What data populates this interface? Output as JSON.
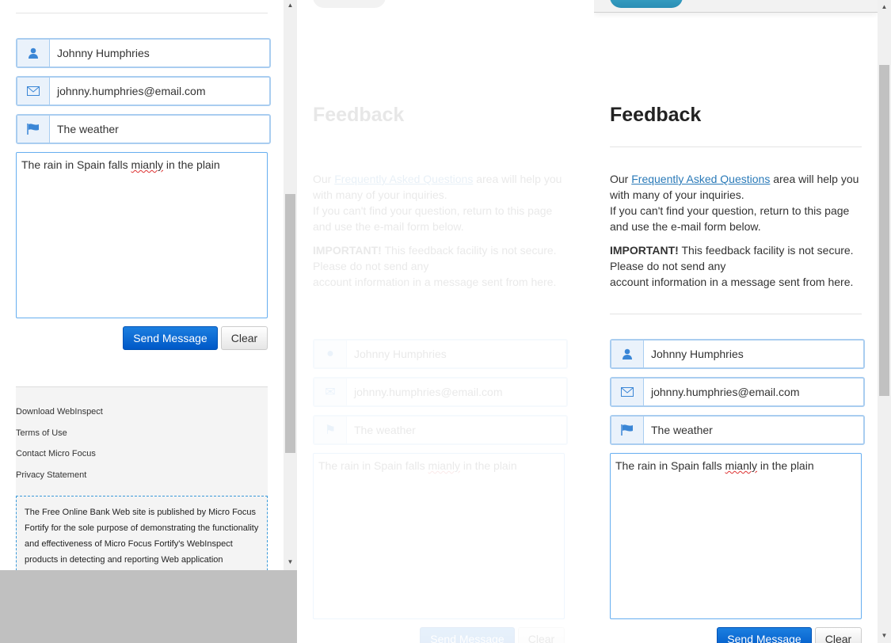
{
  "form": {
    "name": "Johnny Humphries",
    "email": "johnny.humphries@email.com",
    "subject": "The weather",
    "message_before": "The rain in Spain falls ",
    "message_misspelled": "mianly",
    "message_after": " in the plain",
    "send_label": "Send Message",
    "clear_label": "Clear"
  },
  "feedback": {
    "title": "Feedback",
    "intro_before": "Our ",
    "faq_link": "Frequently Asked Questions",
    "intro_after": " area will help you with many of your inquiries.",
    "intro_line2": "If you can't find your question, return to this page and use the e-mail form below.",
    "important_label": "IMPORTANT!",
    "important_text": " This feedback facility is not secure. Please do not send any",
    "important_line2": "account information in a message sent from here."
  },
  "footer": {
    "links": [
      "Download WebInspect",
      "Terms of Use",
      "Contact Micro Focus",
      "Privacy Statement"
    ],
    "disclaimer": "The Free Online Bank Web site is published by Micro Focus Fortify for the sole purpose of demonstrating the functionality and effectiveness of Micro Focus Fortify's WebInspect products in detecting and reporting Web application"
  },
  "colors": {
    "accent": "#0062cc",
    "icon": "#3a86d6",
    "field_border": "#a9cdf0",
    "top_pill": "#2f9fc3"
  }
}
